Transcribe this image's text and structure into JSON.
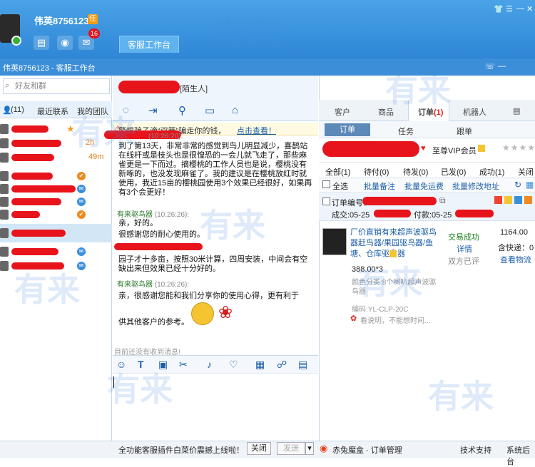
{
  "header": {
    "username": "伟英8756123",
    "level_badge": "任",
    "mail_count": "16",
    "workbench_tab": "客服工作台",
    "subtitle": "伟英8756123 - 客服工作台"
  },
  "left": {
    "search_placeholder": "好友和群",
    "tabs": {
      "contacts": "(11)",
      "recent": "最近联系",
      "team": "我的团队"
    },
    "times": [
      "2h",
      "49m"
    ]
  },
  "chat": {
    "stranger_tag": "[陌生人]",
    "notice": {
      "text": "警惕骗子滴“双簧”骗走你的钱，",
      "link": "点击查看！"
    },
    "messages": [
      {
        "text": "到了第13天，非常非常的感觉到鸟儿明显减少，喜鹊站在线杆或是枝头也是很惶恐的一会儿就飞走了，那些麻雀更是一下而过。摘樱桃的工作人员也是说，樱桃没有新啄的，也没发现麻雀了。我的建议是在樱桃放红时就使用，我近15亩的樱桃园使用3个效果已经很好，如果再有3个会更好！"
      },
      {
        "sender": "有来驱鸟器",
        "time": "(10:26:26):",
        "text": "亲，好的。"
      },
      {
        "text": "很感谢您的耐心使用的。"
      },
      {
        "text": "园子才十多亩，按照30米计算，四周安装，中间会有空缺出来但效果已经十分好的。"
      },
      {
        "sender": "有来驱鸟器",
        "time": "(10:26:26):",
        "text": "亲，很感谢您能和我们分享你的使用心得，更有利于"
      },
      {
        "text": "供其他客户的参考。"
      }
    ],
    "history": "目前还没有收到消息!",
    "bottom_text": "全功能客服插件白菜价震撼上线啦！",
    "close_label": "关闭",
    "send_label": "发送"
  },
  "right": {
    "tabs": [
      "客户",
      "商品",
      "订单",
      "机器人"
    ],
    "order_count": "(1)",
    "subtabs": [
      "订单",
      "任务",
      "跟单"
    ],
    "vip": "至尊VIP会员",
    "stars": "★★★★",
    "filters": [
      "全部(1)",
      "待付(0)",
      "待发(0)",
      "已发(0)",
      "成功(1)",
      "关闭("
    ],
    "checks": [
      "全选",
      "批量备注",
      "批量免运费",
      "批量修改地址"
    ],
    "order": {
      "number_label": "订单编号：",
      "deal_label": "成交:05-25",
      "pay_label": "付款:05-25",
      "title": "厂价直销有来超声波驱鸟器赶鸟器/果园驱鸟器/鱼塘、仓库驱鸟器",
      "price": "388.00*3",
      "attr": "颜色分类:8个喇叭超声波驱鸟器",
      "code": "编码:YL-CLP-20C",
      "note": "看说明，不能想时间...",
      "trade_status": "交易成功",
      "detail_link": "详情",
      "rating": "双方已评",
      "amount": "1164.00",
      "shipping": "含快递：0",
      "logistics_link": "查看物流"
    },
    "footer_brand": "赤兔魔盒 · 订单管理",
    "footer_support": "技术支持",
    "footer_admin": "系统后台"
  },
  "watermark": "有来"
}
